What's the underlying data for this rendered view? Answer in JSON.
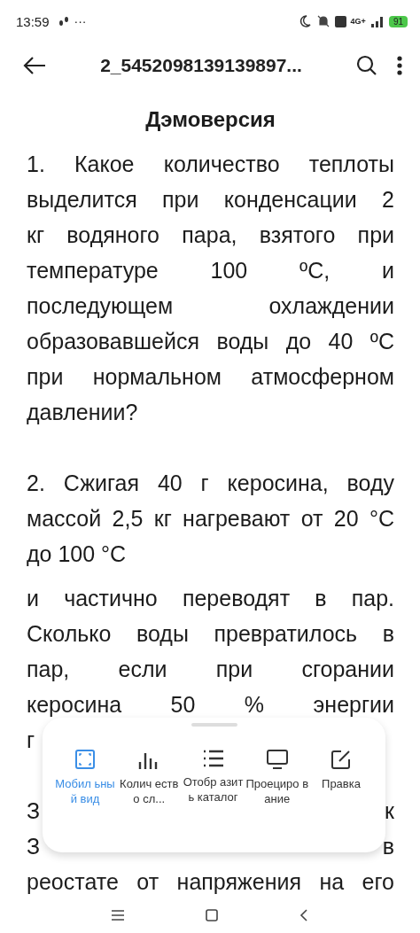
{
  "status_bar": {
    "time": "13:59",
    "dots": "···",
    "network": "4G+",
    "battery": "91"
  },
  "toolbar": {
    "title": "2_5452098139139897..."
  },
  "document": {
    "title": "Дэмоверсия",
    "blocks": [
      {
        "lines": [
          "1. Какое количество теплоты",
          "выделится при конденсации 2",
          "кг водяного пара, взятого при",
          "температуре 100 ºС, и",
          "последующем охлаждении",
          "образовавшейся воды до 40 ºС",
          "при нормальном атмосферном",
          "давлении?"
        ]
      },
      {
        "lines": [
          "2. Сжигая 40 г керосина, воду",
          "массой 2,5 кг нагревают от 20 °С",
          "до 100 °С"
        ]
      },
      {
        "lines": [
          "и частично переводят в пар.",
          "Сколько воды превратилось в",
          "пар, если при сгорании",
          "керосина 50 % энергии",
          "г"
        ]
      },
      {
        "lines": [
          [
            "З",
            "к"
          ],
          [
            "З",
            "в"
          ],
          "реостате от напряжения на его"
        ]
      }
    ]
  },
  "menu": {
    "items": [
      {
        "label": "Мобил ьный вид",
        "selected": true
      },
      {
        "label": "Колич ество сл...",
        "selected": false
      },
      {
        "label": "Отобр азить каталог",
        "selected": false
      },
      {
        "label": "Проециро вание",
        "selected": false
      },
      {
        "label": "Правка",
        "selected": false
      }
    ]
  }
}
